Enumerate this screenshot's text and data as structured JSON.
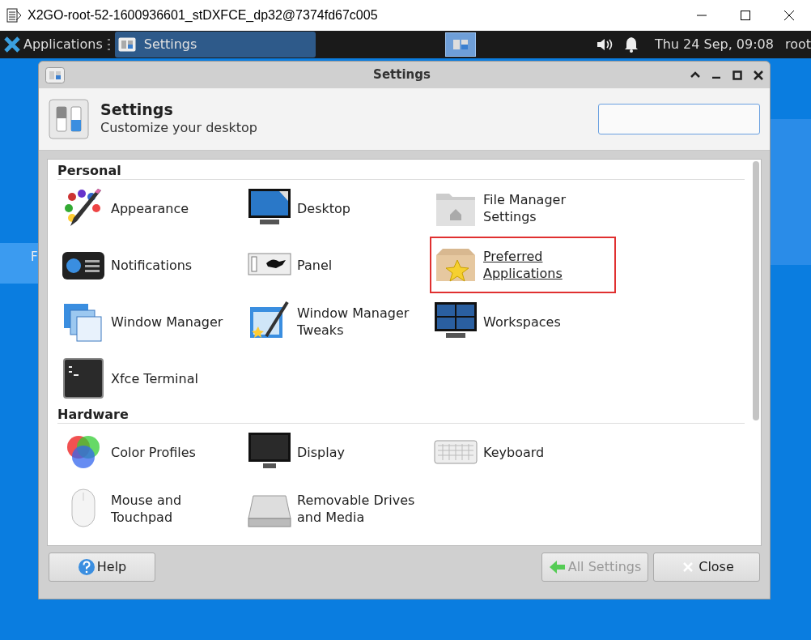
{
  "host_window": {
    "title": "X2GO-root-52-1600936601_stDXFCE_dp32@7374fd67c005"
  },
  "panel": {
    "menu_label": "Applications",
    "tasks": [
      {
        "label": "Settings",
        "selected": true
      }
    ],
    "clock": "Thu 24 Sep, 09:08",
    "user": "root"
  },
  "desktop": {
    "partial_label": "F"
  },
  "window": {
    "title": "Settings"
  },
  "header": {
    "title": "Settings",
    "subtitle": "Customize your desktop"
  },
  "sections": [
    {
      "title": "Personal",
      "items": [
        {
          "label": "Appearance",
          "highlighted": false
        },
        {
          "label": "Desktop",
          "highlighted": false
        },
        {
          "label": "File Manager Settings",
          "highlighted": false
        },
        {
          "label": "Notifications",
          "highlighted": false
        },
        {
          "label": "Panel",
          "highlighted": false
        },
        {
          "label": "Preferred Applications",
          "highlighted": true
        },
        {
          "label": "Window Manager",
          "highlighted": false
        },
        {
          "label": "Window Manager Tweaks",
          "highlighted": false
        },
        {
          "label": "Workspaces",
          "highlighted": false
        },
        {
          "label": "Xfce Terminal",
          "highlighted": false
        }
      ]
    },
    {
      "title": "Hardware",
      "items": [
        {
          "label": "Color Profiles",
          "highlighted": false
        },
        {
          "label": "Display",
          "highlighted": false
        },
        {
          "label": "Keyboard",
          "highlighted": false
        },
        {
          "label": "Mouse and Touchpad",
          "highlighted": false
        },
        {
          "label": "Removable Drives and Media",
          "highlighted": false
        }
      ]
    }
  ],
  "buttons": [
    {
      "label": "Help",
      "disabled": false
    },
    {
      "label": "All Settings",
      "disabled": true
    },
    {
      "label": "Close",
      "disabled": false
    }
  ]
}
